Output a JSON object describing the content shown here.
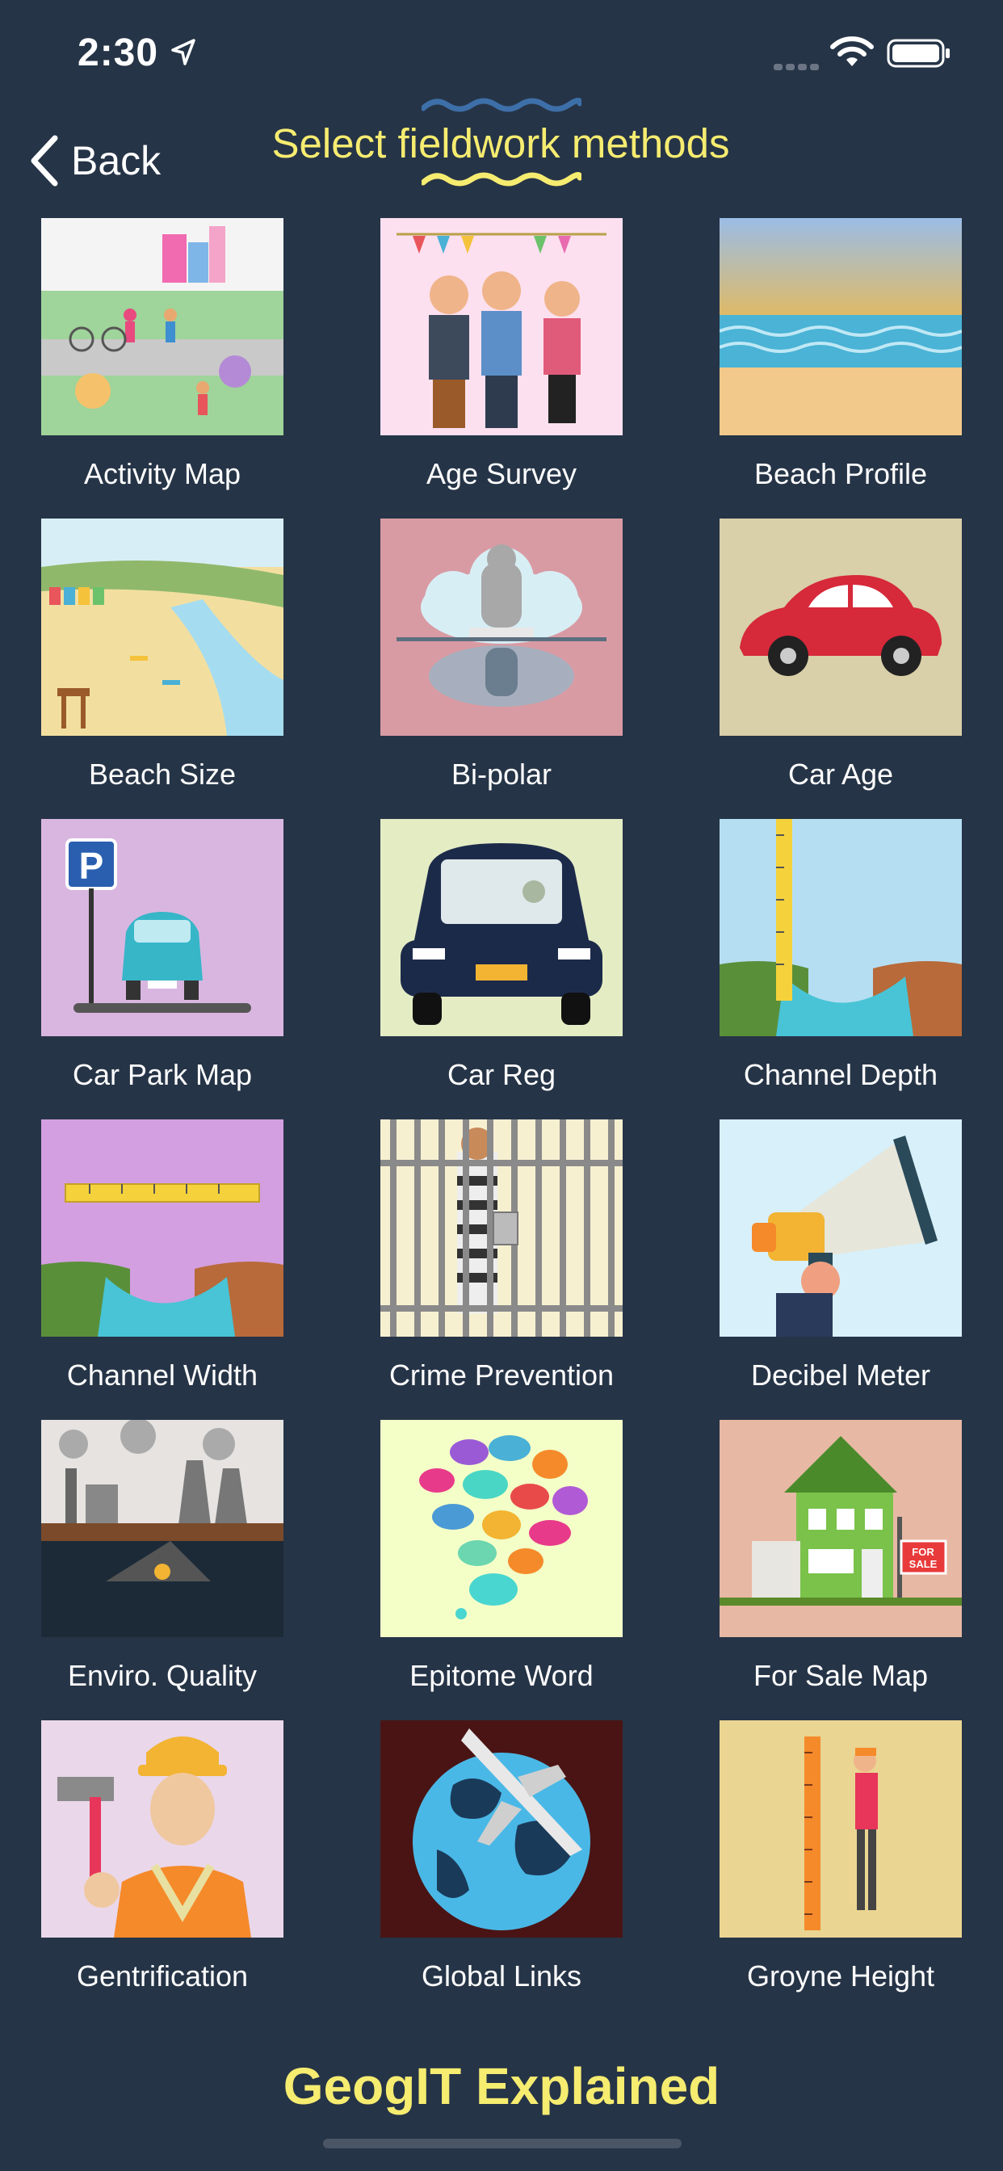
{
  "status_bar": {
    "time": "2:30"
  },
  "nav": {
    "back_label": "Back",
    "title": "Select fieldwork methods"
  },
  "methods": [
    {
      "label": "Activity Map",
      "thumb_bg": "#9fd49a"
    },
    {
      "label": "Age Survey",
      "thumb_bg": "#fce0ef"
    },
    {
      "label": "Beach Profile",
      "thumb_bg": "#f5b94c"
    },
    {
      "label": "Beach Size",
      "thumb_bg": "#f2dfa0"
    },
    {
      "label": "Bi-polar",
      "thumb_bg": "#d99ba3"
    },
    {
      "label": "Car Age",
      "thumb_bg": "#d9cfa8"
    },
    {
      "label": "Car Park Map",
      "thumb_bg": "#d9b6e0"
    },
    {
      "label": "Car Reg",
      "thumb_bg": "#e4ecc4"
    },
    {
      "label": "Channel Depth",
      "thumb_bg": "#b6def2"
    },
    {
      "label": "Channel Width",
      "thumb_bg": "#d39fe0"
    },
    {
      "label": "Crime Prevention",
      "thumb_bg": "#f7f0d0"
    },
    {
      "label": "Decibel Meter",
      "thumb_bg": "#d8f0fa"
    },
    {
      "label": "Enviro. Quality",
      "thumb_bg": "#1c2a38"
    },
    {
      "label": "Epitome Word",
      "thumb_bg": "#f4ffc8"
    },
    {
      "label": "For Sale Map",
      "thumb_bg": "#e7b8a4"
    },
    {
      "label": "Gentrification",
      "thumb_bg": "#ead7ea"
    },
    {
      "label": "Global Links",
      "thumb_bg": "#4a1414"
    },
    {
      "label": "Groyne Height",
      "thumb_bg": "#ead592"
    }
  ],
  "footer": {
    "title": "GeogIT Explained"
  },
  "colors": {
    "background": "#263447",
    "accent_yellow": "#f6ec70",
    "wave_blue": "#3d6fa8"
  }
}
